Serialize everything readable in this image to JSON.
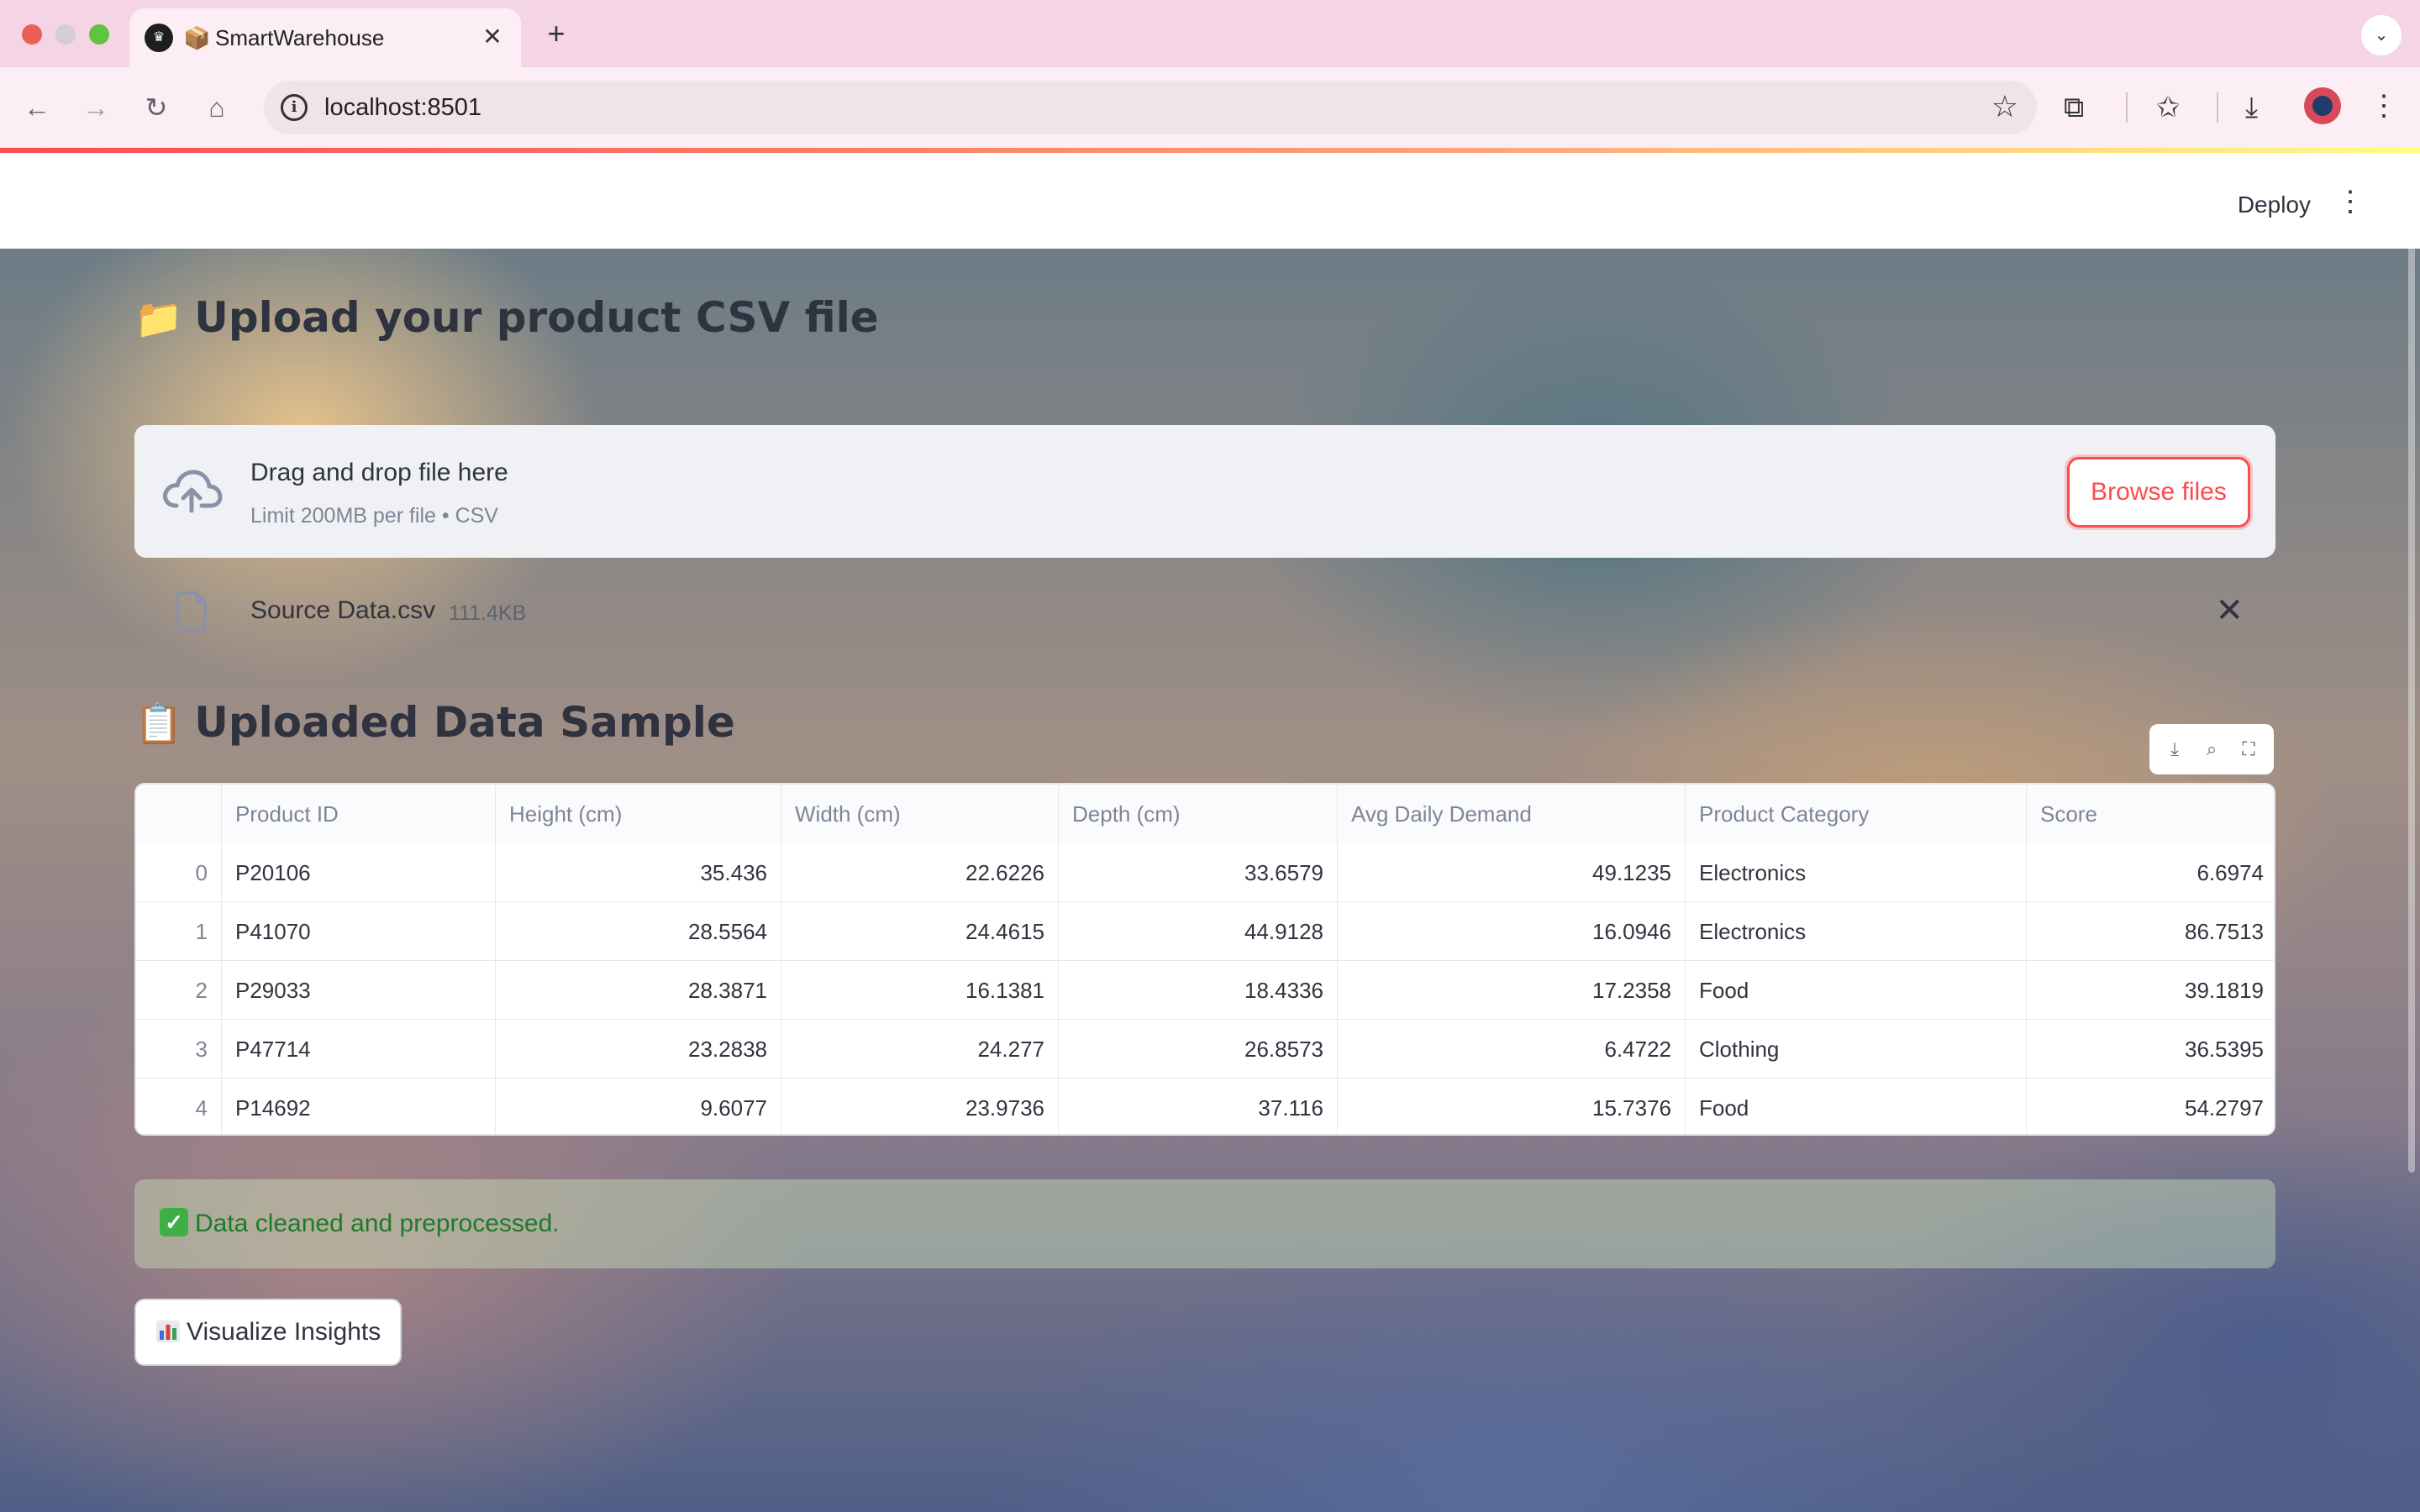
{
  "browser": {
    "tab_title": "SmartWarehouse",
    "url": "localhost:8501"
  },
  "app_header": {
    "deploy_label": "Deploy"
  },
  "upload_section": {
    "heading_emoji": "📁",
    "heading": "Upload your product CSV file",
    "drag_title": "Drag and drop file here",
    "limit_text": "Limit 200MB per file • CSV",
    "browse_label": "Browse files"
  },
  "uploaded_file": {
    "name": "Source Data.csv",
    "size": "111.4KB"
  },
  "sample_section": {
    "heading_emoji": "📋",
    "heading": "Uploaded Data Sample",
    "columns": [
      "",
      "Product ID",
      "Height (cm)",
      "Width (cm)",
      "Depth (cm)",
      "Avg Daily Demand",
      "Product Category",
      "Score"
    ],
    "rows": [
      [
        "0",
        "P20106",
        "35.436",
        "22.6226",
        "33.6579",
        "49.1235",
        "Electronics",
        "6.6974"
      ],
      [
        "1",
        "P41070",
        "28.5564",
        "24.4615",
        "44.9128",
        "16.0946",
        "Electronics",
        "86.7513"
      ],
      [
        "2",
        "P29033",
        "28.3871",
        "16.1381",
        "18.4336",
        "17.2358",
        "Food",
        "39.1819"
      ],
      [
        "3",
        "P47714",
        "23.2838",
        "24.277",
        "26.8573",
        "6.4722",
        "Clothing",
        "36.5395"
      ],
      [
        "4",
        "P14692",
        "9.6077",
        "23.9736",
        "37.116",
        "15.7376",
        "Food",
        "54.2797"
      ]
    ]
  },
  "status": {
    "success_text": "Data cleaned and preprocessed."
  },
  "actions": {
    "visualize_label": "Visualize Insights"
  },
  "colors": {
    "accent": "#ff4b4b",
    "success": "#1f7a2a"
  }
}
